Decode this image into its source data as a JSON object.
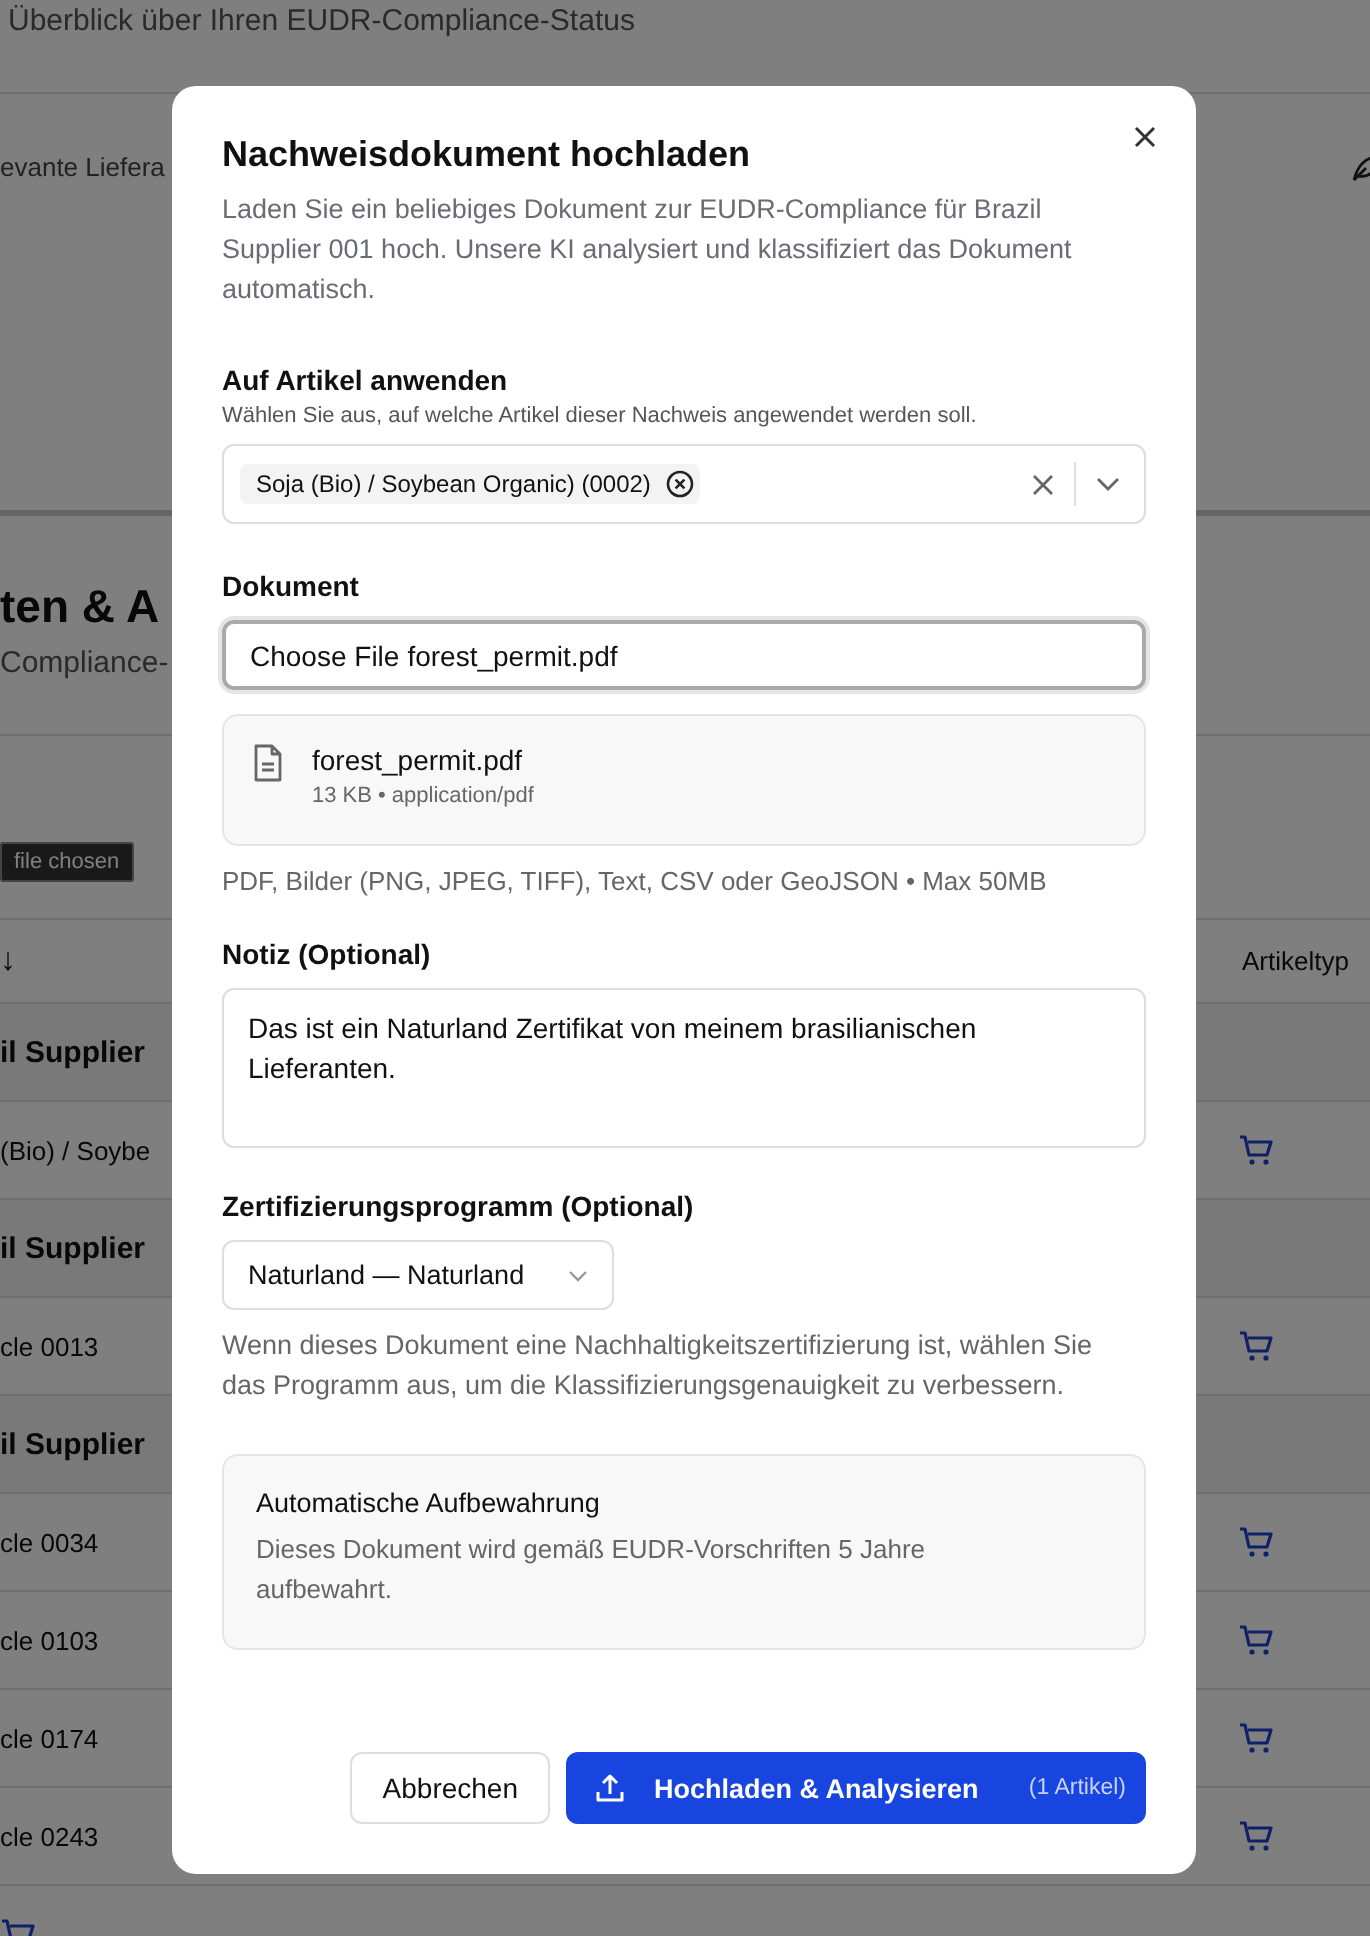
{
  "background": {
    "subtitle": "Überblick über Ihren EUDR-Compliance-Status",
    "filter_label": "evante Liefera",
    "section_title": "ten & A",
    "section_subtitle": "Compliance-",
    "tooltip": "file chosen",
    "table": {
      "sort_mark": "↓",
      "type_column": "Artikeltyp",
      "rows": [
        {
          "kind": "group",
          "label": "il Supplier"
        },
        {
          "kind": "item",
          "label": "(Bio) / Soybe"
        },
        {
          "kind": "group",
          "label": "il Supplier"
        },
        {
          "kind": "item",
          "label": "cle 0013"
        },
        {
          "kind": "group",
          "label": "il Supplier"
        },
        {
          "kind": "item",
          "label": "cle 0034"
        },
        {
          "kind": "item",
          "label": "cle 0103"
        },
        {
          "kind": "item",
          "label": "cle 0174"
        },
        {
          "kind": "item",
          "label": "cle 0243"
        },
        {
          "kind": "item",
          "label": ""
        }
      ]
    }
  },
  "dialog": {
    "title": "Nachweisdokument hochladen",
    "description": "Laden Sie ein beliebiges Dokument zur EUDR-Compliance für Brazil Supplier 001 hoch. Unsere KI analysiert und klassifiziert das Dokument automatisch.",
    "articles": {
      "label": "Auf Artikel anwenden",
      "hint": "Wählen Sie aus, auf welche Artikel dieser Nachweis angewendet werden soll.",
      "tags": [
        "Soja (Bio) / Soybean Organic) (0002)"
      ]
    },
    "document": {
      "label": "Dokument",
      "button": "Choose File",
      "file_name": "forest_permit.pdf",
      "file_card": {
        "name": "forest_permit.pdf",
        "meta": "13 KB • application/pdf"
      },
      "hint": "PDF, Bilder (PNG, JPEG, TIFF), Text, CSV oder GeoJSON • Max 50MB"
    },
    "note": {
      "label": "Notiz (Optional)",
      "value": "Das ist ein Naturland Zertifikat von meinem brasilianischen Lieferanten."
    },
    "program": {
      "label": "Zertifizierungsprogramm (Optional)",
      "value": "Naturland — Naturland",
      "hint": "Wenn dieses Dokument eine Nachhaltigkeitszertifizierung ist, wählen Sie das Programm aus, um die Klassifizierungsgenauigkeit zu verbessern."
    },
    "retention": {
      "title": "Automatische Aufbewahrung",
      "text": "Dieses Dokument wird gemäß EUDR-Vorschriften 5 Jahre aufbewahrt."
    },
    "cancel": "Abbrechen",
    "submit": "Hochladen & Analysieren",
    "submit_count": "(1 Artikel)"
  }
}
